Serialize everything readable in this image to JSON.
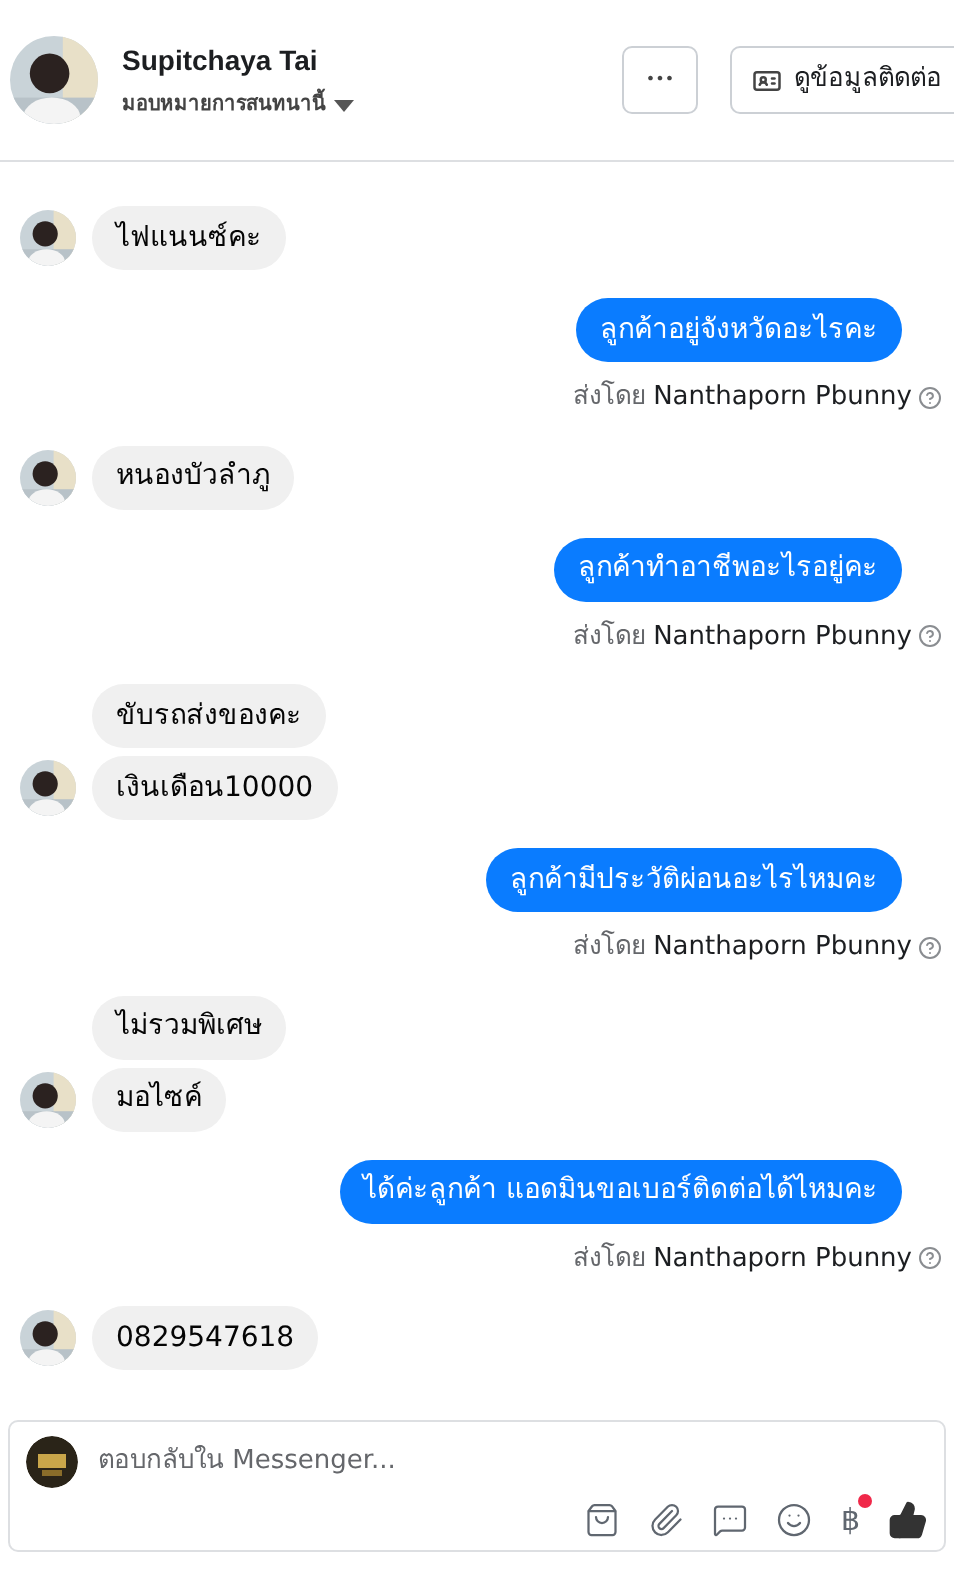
{
  "header": {
    "name": "Supitchaya Tai",
    "assign_label": "มอบหมายการสนทนานี้",
    "more_button": "•••",
    "contact_button": "ดูข้อมูลติดต่อ"
  },
  "groups": [
    {
      "kind": "incoming",
      "messages": [
        "ไฟแนนซ์คะ"
      ]
    },
    {
      "kind": "outgoing",
      "messages": [
        "ลูกค้าอยู่จังหวัดอะไรคะ"
      ],
      "sent_by": "ส่งโดย",
      "sender": "Nanthaporn Pbunny"
    },
    {
      "kind": "incoming",
      "messages": [
        "หนองบัวลำภู"
      ]
    },
    {
      "kind": "outgoing",
      "messages": [
        "ลูกค้าทำอาชีพอะไรอยู่คะ"
      ],
      "sent_by": "ส่งโดย",
      "sender": "Nanthaporn Pbunny"
    },
    {
      "kind": "incoming",
      "messages": [
        "ขับรถส่งของคะ",
        "เงินเดือน10000"
      ]
    },
    {
      "kind": "outgoing",
      "messages": [
        "ลูกค้ามีประวัติผ่อนอะไรไหมคะ"
      ],
      "sent_by": "ส่งโดย",
      "sender": "Nanthaporn Pbunny"
    },
    {
      "kind": "incoming",
      "messages": [
        "ไม่รวมพิเศษ",
        "มอไซค์"
      ]
    },
    {
      "kind": "outgoing",
      "messages": [
        "ได้ค่ะลูกค้า แอดมินขอเบอร์ติดต่อได้ไหมคะ"
      ],
      "sent_by": "ส่งโดย",
      "sender": "Nanthaporn Pbunny"
    },
    {
      "kind": "incoming",
      "messages": [
        "0829547618"
      ]
    }
  ],
  "composer": {
    "placeholder": "ตอบกลับใน Messenger...",
    "payment_symbol": "฿",
    "payment_notification": true
  }
}
